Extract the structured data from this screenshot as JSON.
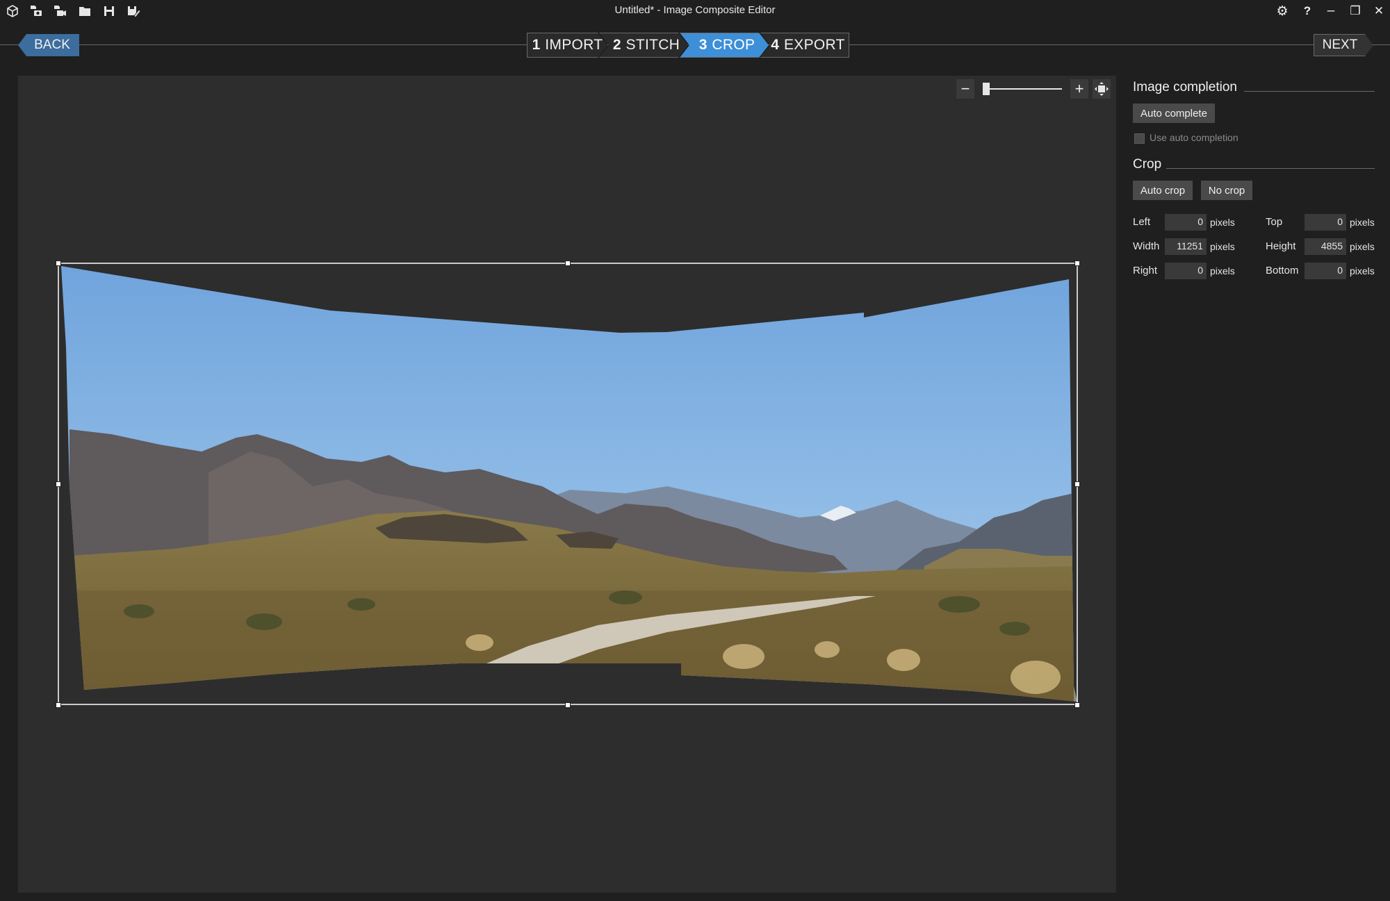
{
  "window": {
    "title": "Untitled* - Image Composite Editor",
    "toolbar_icons": [
      "new-project-icon",
      "new-panorama-from-images-icon",
      "new-panorama-from-video-icon",
      "open-folder-icon",
      "save-icon",
      "save-as-icon"
    ],
    "controls": {
      "settings": "⚙",
      "help": "?",
      "minimize": "–",
      "restore": "❐",
      "close": "✕"
    }
  },
  "nav": {
    "back_label": "BACK",
    "next_label": "NEXT",
    "steps": [
      {
        "num": "1",
        "label": "IMPORT",
        "active": false
      },
      {
        "num": "2",
        "label": "STITCH",
        "active": false
      },
      {
        "num": "3",
        "label": "CROP",
        "active": true
      },
      {
        "num": "4",
        "label": "EXPORT",
        "active": false
      }
    ]
  },
  "zoom": {
    "minus": "−",
    "plus": "+",
    "level_fraction": 0.02
  },
  "panel": {
    "image_completion": {
      "title": "Image completion",
      "auto_complete_label": "Auto complete",
      "use_auto_completion_label": "Use auto completion",
      "use_auto_completion_checked": false
    },
    "crop": {
      "title": "Crop",
      "auto_crop_label": "Auto crop",
      "no_crop_label": "No crop",
      "unit": "pixels",
      "fields": {
        "left": {
          "label": "Left",
          "value": "0"
        },
        "top": {
          "label": "Top",
          "value": "0"
        },
        "width": {
          "label": "Width",
          "value": "11251"
        },
        "height": {
          "label": "Height",
          "value": "4855"
        },
        "right": {
          "label": "Right",
          "value": "0"
        },
        "bottom": {
          "label": "Bottom",
          "value": "0"
        }
      }
    }
  },
  "colors": {
    "accent": "#3d8fd8",
    "back_button": "#3c6d9d",
    "canvas": "#2d2d2d",
    "background": "#1f1f1f"
  }
}
